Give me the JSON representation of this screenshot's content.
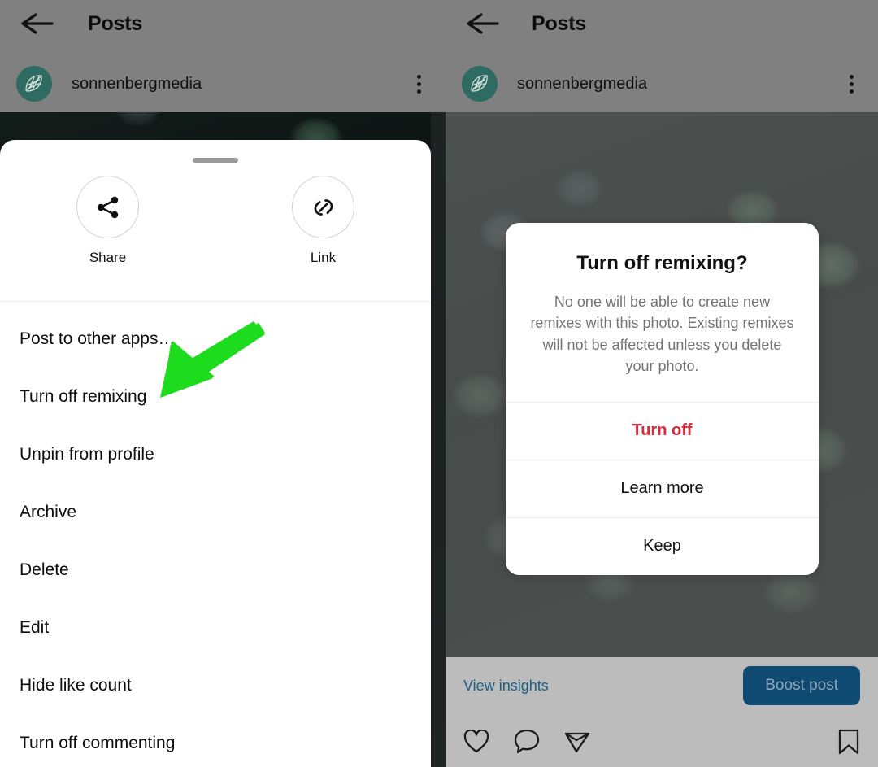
{
  "left_screen": {
    "header": {
      "back_icon": "back-arrow-icon",
      "title": "Posts",
      "username": "sonnenbergmedia",
      "avatar_icon": "leaf-logo-avatar",
      "overflow_icon": "more-options-icon"
    },
    "share_sheet": {
      "grabber": "drag-handle",
      "quick_actions": [
        {
          "label": "Share",
          "icon": "share-nodes-icon"
        },
        {
          "label": "Link",
          "icon": "link-chain-icon"
        }
      ],
      "menu_items": [
        "Post to other apps…",
        "Turn off remixing",
        "Unpin from profile",
        "Archive",
        "Delete",
        "Edit",
        "Hide like count",
        "Turn off commenting"
      ]
    },
    "annotation": {
      "type": "arrow",
      "color": "#1ddb1d",
      "points_to": "Turn off remixing"
    }
  },
  "right_screen": {
    "header": {
      "back_icon": "back-arrow-icon",
      "title": "Posts",
      "username": "sonnenbergmedia",
      "avatar_icon": "leaf-logo-avatar",
      "overflow_icon": "more-options-icon"
    },
    "dialog": {
      "title": "Turn off remixing?",
      "message": "No one will be able to create new remixes with this photo. Existing remixes will not be affected unless you delete your photo.",
      "buttons": [
        {
          "label": "Turn off",
          "style": "destructive",
          "color": "#d32b3a"
        },
        {
          "label": "Learn more",
          "style": "default"
        },
        {
          "label": "Keep",
          "style": "default"
        }
      ]
    },
    "bottom_bar": {
      "insights_label": "View insights",
      "insights_color": "#1b5e85",
      "boost_label": "Boost post",
      "boost_color": "#0f4a73",
      "actions": [
        "like-heart-icon",
        "comment-bubble-icon",
        "share-paper-plane-icon",
        "save-bookmark-icon"
      ]
    }
  }
}
